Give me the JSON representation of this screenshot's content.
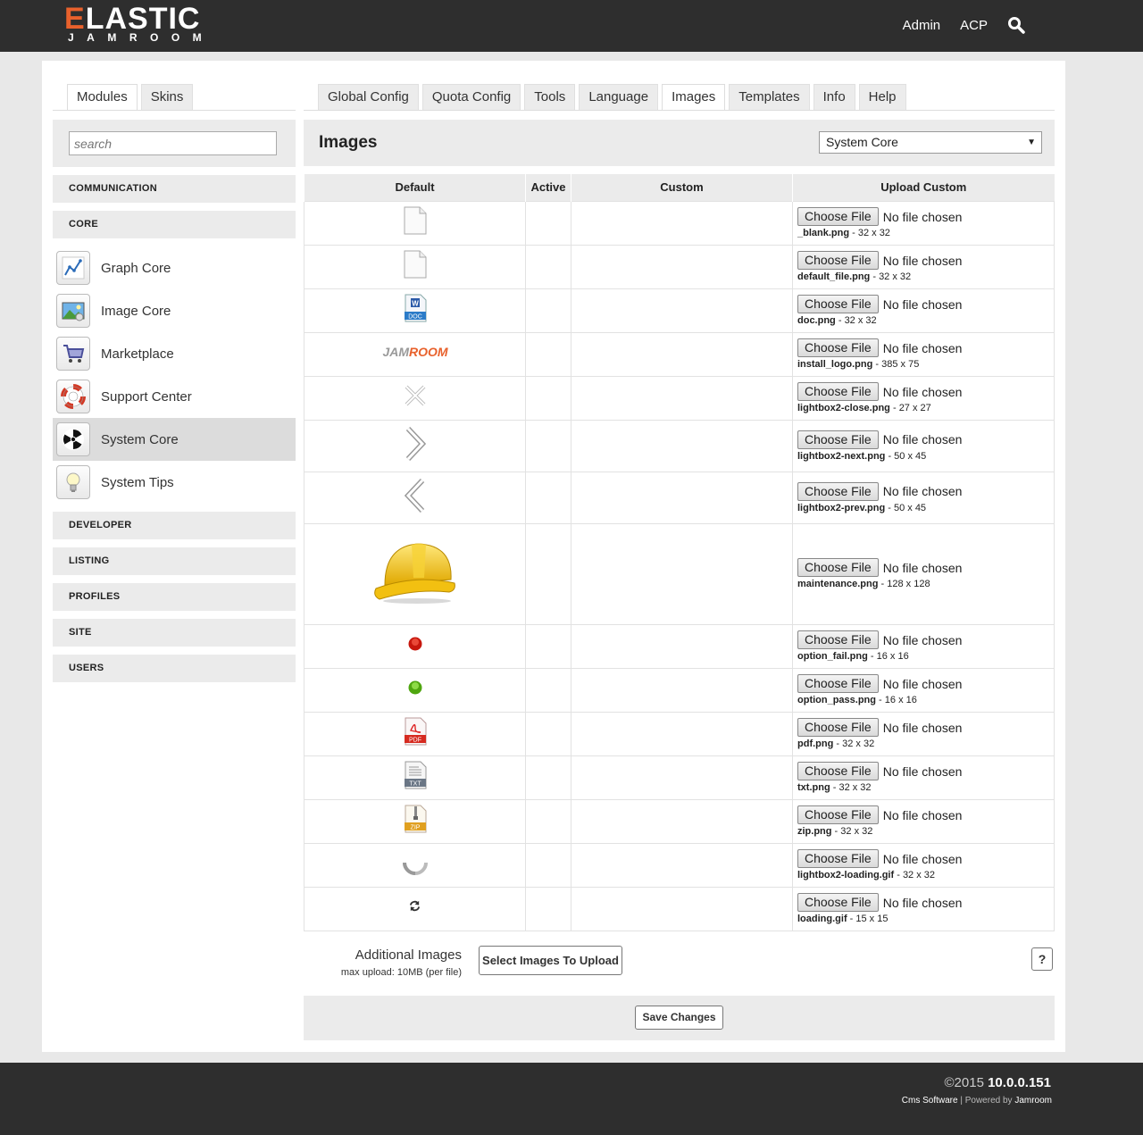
{
  "header": {
    "logo_main": "ELASTIC",
    "logo_sub": "JAMROOM",
    "nav": [
      "Admin",
      "ACP"
    ],
    "search_icon": "search-icon"
  },
  "left_tabs": [
    "Modules",
    "Skins"
  ],
  "right_tabs": [
    "Global Config",
    "Quota Config",
    "Tools",
    "Language",
    "Images",
    "Templates",
    "Info",
    "Help"
  ],
  "sidebar": {
    "search_placeholder": "search",
    "categories": [
      "COMMUNICATION",
      "CORE",
      "DEVELOPER",
      "LISTING",
      "PROFILES",
      "SITE",
      "USERS"
    ],
    "modules": [
      {
        "label": "Graph Core",
        "icon": "graph-icon"
      },
      {
        "label": "Image Core",
        "icon": "image-icon"
      },
      {
        "label": "Marketplace",
        "icon": "cart-icon"
      },
      {
        "label": "Support Center",
        "icon": "lifebuoy-icon"
      },
      {
        "label": "System Core",
        "icon": "radiation-icon"
      },
      {
        "label": "System Tips",
        "icon": "lightbulb-icon"
      }
    ]
  },
  "content": {
    "title": "Images",
    "module_select": "System Core",
    "columns": [
      "Default",
      "Active",
      "Custom",
      "Upload Custom"
    ],
    "choose_label": "Choose File",
    "nofile_label": "No file chosen",
    "rows": [
      {
        "file": "_blank.png",
        "size": "32 x 32",
        "icon": "blank-file-icon"
      },
      {
        "file": "default_file.png",
        "size": "32 x 32",
        "icon": "default-file-icon"
      },
      {
        "file": "doc.png",
        "size": "32 x 32",
        "icon": "doc-icon"
      },
      {
        "file": "install_logo.png",
        "size": "385 x 75",
        "icon": "jamroom-logo-icon"
      },
      {
        "file": "lightbox2-close.png",
        "size": "27 x 27",
        "icon": "close-icon"
      },
      {
        "file": "lightbox2-next.png",
        "size": "50 x 45",
        "icon": "chevron-right-icon"
      },
      {
        "file": "lightbox2-prev.png",
        "size": "50 x 45",
        "icon": "chevron-left-icon"
      },
      {
        "file": "maintenance.png",
        "size": "128 x 128",
        "icon": "hard-hat-icon"
      },
      {
        "file": "option_fail.png",
        "size": "16 x 16",
        "icon": "red-dot-icon"
      },
      {
        "file": "option_pass.png",
        "size": "16 x 16",
        "icon": "green-dot-icon"
      },
      {
        "file": "pdf.png",
        "size": "32 x 32",
        "icon": "pdf-icon"
      },
      {
        "file": "txt.png",
        "size": "32 x 32",
        "icon": "txt-icon"
      },
      {
        "file": "zip.png",
        "size": "32 x 32",
        "icon": "zip-icon"
      },
      {
        "file": "lightbox2-loading.gif",
        "size": "32 x 32",
        "icon": "loading-spinner-icon"
      },
      {
        "file": "loading.gif",
        "size": "15 x 15",
        "icon": "refresh-icon"
      }
    ],
    "doc_badge": "DOC",
    "pdf_badge": "PDF",
    "txt_badge": "TXT",
    "zip_badge": "ZIP",
    "jamroom_word": "JAMROOM"
  },
  "additional": {
    "title": "Additional Images",
    "subtitle": "max upload: 10MB (per file)",
    "button": "Select Images To Upload",
    "help": "?"
  },
  "save_button": "Save Changes",
  "footer": {
    "copyright": "©2015",
    "version": "10.0.0.151",
    "cms": "Cms Software",
    "powered_prefix": "Powered by",
    "powered_brand": "Jamroom"
  }
}
